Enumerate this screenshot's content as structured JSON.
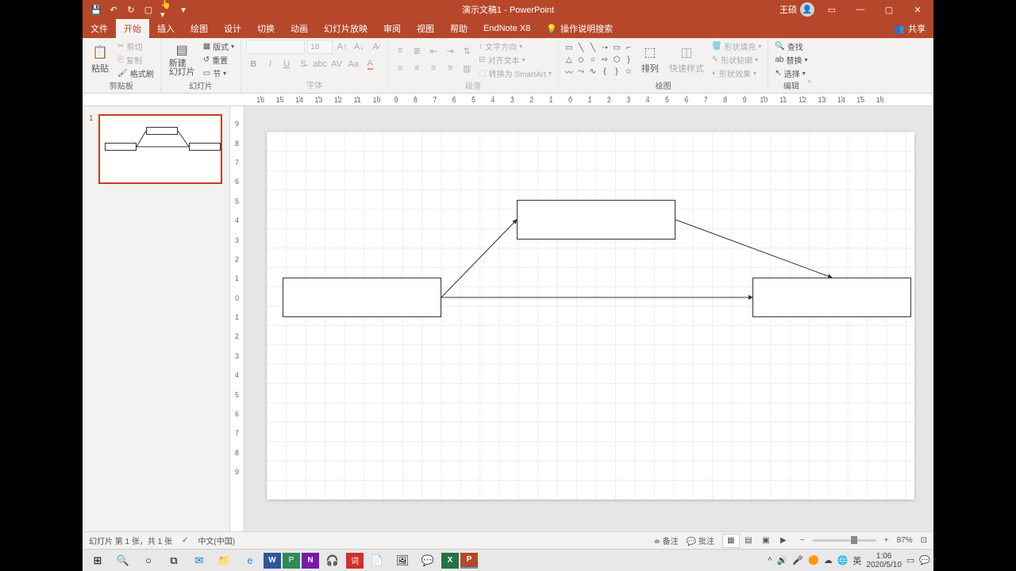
{
  "titlebar": {
    "doc_title": "演示文稿1 - PowerPoint",
    "user_name": "王硕"
  },
  "menu": {
    "tabs": [
      "文件",
      "开始",
      "插入",
      "绘图",
      "设计",
      "切换",
      "动画",
      "幻灯片放映",
      "审阅",
      "视图",
      "帮助",
      "EndNote X8"
    ],
    "tell_me": "操作说明搜索",
    "share": "共享"
  },
  "ribbon": {
    "clipboard": {
      "label": "剪贴板",
      "paste": "粘贴",
      "cut": "剪切",
      "copy": "复制",
      "format_painter": "格式刷"
    },
    "slides": {
      "label": "幻灯片",
      "new_slide": "新建\n幻灯片",
      "layout": "版式",
      "reset": "重置",
      "section": "节"
    },
    "font": {
      "label": "字体",
      "size": "18"
    },
    "paragraph": {
      "label": "段落",
      "text_direction": "文字方向",
      "align_text": "对齐文本",
      "smartart": "转换为 SmartArt"
    },
    "drawing": {
      "label": "绘图",
      "arrange": "排列",
      "quick_styles": "快速样式",
      "shape_fill": "形状填充",
      "shape_outline": "形状轮廓",
      "shape_effects": "形状效果"
    },
    "editing": {
      "label": "编辑",
      "find": "查找",
      "replace": "替换",
      "select": "选择"
    }
  },
  "ruler_h": [
    "16",
    "15",
    "14",
    "13",
    "12",
    "11",
    "10",
    "9",
    "8",
    "7",
    "6",
    "5",
    "4",
    "3",
    "2",
    "1",
    "0",
    "1",
    "2",
    "3",
    "4",
    "5",
    "6",
    "7",
    "8",
    "9",
    "10",
    "11",
    "12",
    "13",
    "14",
    "15",
    "16"
  ],
  "ruler_v": [
    "9",
    "8",
    "7",
    "6",
    "5",
    "4",
    "3",
    "2",
    "1",
    "0",
    "1",
    "2",
    "3",
    "4",
    "5",
    "6",
    "7",
    "8",
    "9"
  ],
  "thumbnails": {
    "slide1_num": "1"
  },
  "statusbar": {
    "slide_info": "幻灯片 第 1 张，共 1 张",
    "language": "中文(中国)",
    "notes": "备注",
    "comments": "批注",
    "zoom": "87%"
  },
  "taskbar": {
    "time": "1:06",
    "date": "2020/5/10",
    "ime": "英"
  }
}
